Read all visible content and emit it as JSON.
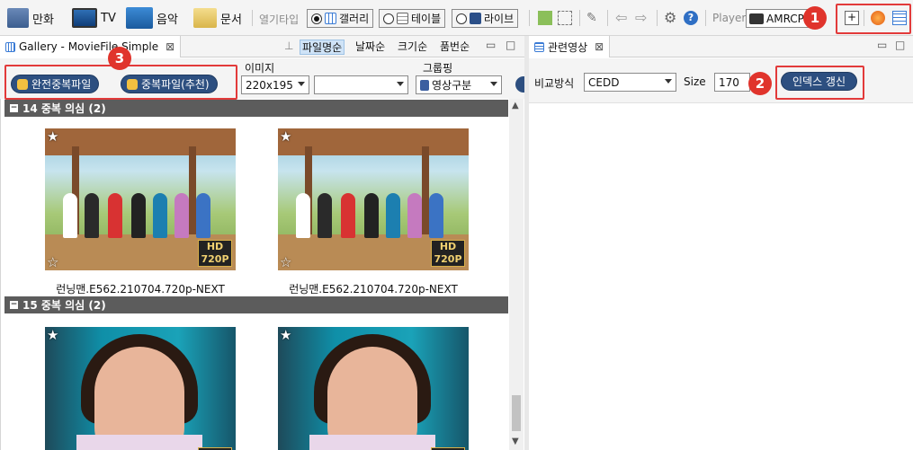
{
  "toolbar": {
    "items": [
      {
        "label": "만화",
        "icon": "comic-folder-icon"
      },
      {
        "label": "TV",
        "icon": "tv-icon"
      },
      {
        "label": "음악",
        "icon": "music-icon"
      },
      {
        "label": "문서",
        "icon": "document-folder-icon"
      }
    ],
    "open_type_label": "열기타입",
    "view_modes": [
      {
        "label": "갤러리",
        "selected": true
      },
      {
        "label": "테이블",
        "selected": false
      },
      {
        "label": "라이브",
        "selected": false
      }
    ],
    "player_label": "Player",
    "player_value": "AMRCP"
  },
  "gallery": {
    "tab_title": "Gallery - MovieFile Simple",
    "sort_options": [
      {
        "label": "파일명순",
        "active": true
      },
      {
        "label": "날짜순",
        "active": false
      },
      {
        "label": "크기순",
        "active": false
      },
      {
        "label": "품번순",
        "active": false
      }
    ],
    "buttons": {
      "exact_duplicates": "완전중복파일",
      "recommended_duplicates": "중복파일(추천)"
    },
    "image_label": "이미지",
    "image_size_value": "220x195",
    "second_select_value": "",
    "grouping_label": "그룹핑",
    "grouping_value": "영상구분",
    "groups": [
      {
        "title": "14 중복 의심 (2)",
        "items": [
          {
            "filename": "런닝맨.E562.210704.720p-NEXT",
            "hd": "HD",
            "res": "720P"
          },
          {
            "filename": "런닝맨.E562.210704.720p-NEXT",
            "hd": "HD",
            "res": "720P"
          }
        ]
      },
      {
        "title": "15 중복 의심 (2)",
        "items": [
          {
            "filename": "",
            "hd": "HD",
            "res": ""
          },
          {
            "filename": "",
            "hd": "HD",
            "res": ""
          }
        ]
      }
    ]
  },
  "related": {
    "tab_title": "관련영상",
    "compare_label": "비교방식",
    "compare_value": "CEDD",
    "size_label": "Size",
    "size_value": "170",
    "update_button": "인덱스 갱신"
  },
  "annotations": {
    "badge1": "1",
    "badge2": "2",
    "badge3": "3"
  },
  "colors": {
    "accent_red": "#e0342c",
    "pill_blue": "#2d4f80",
    "group_bar": "#5c5c5c"
  }
}
